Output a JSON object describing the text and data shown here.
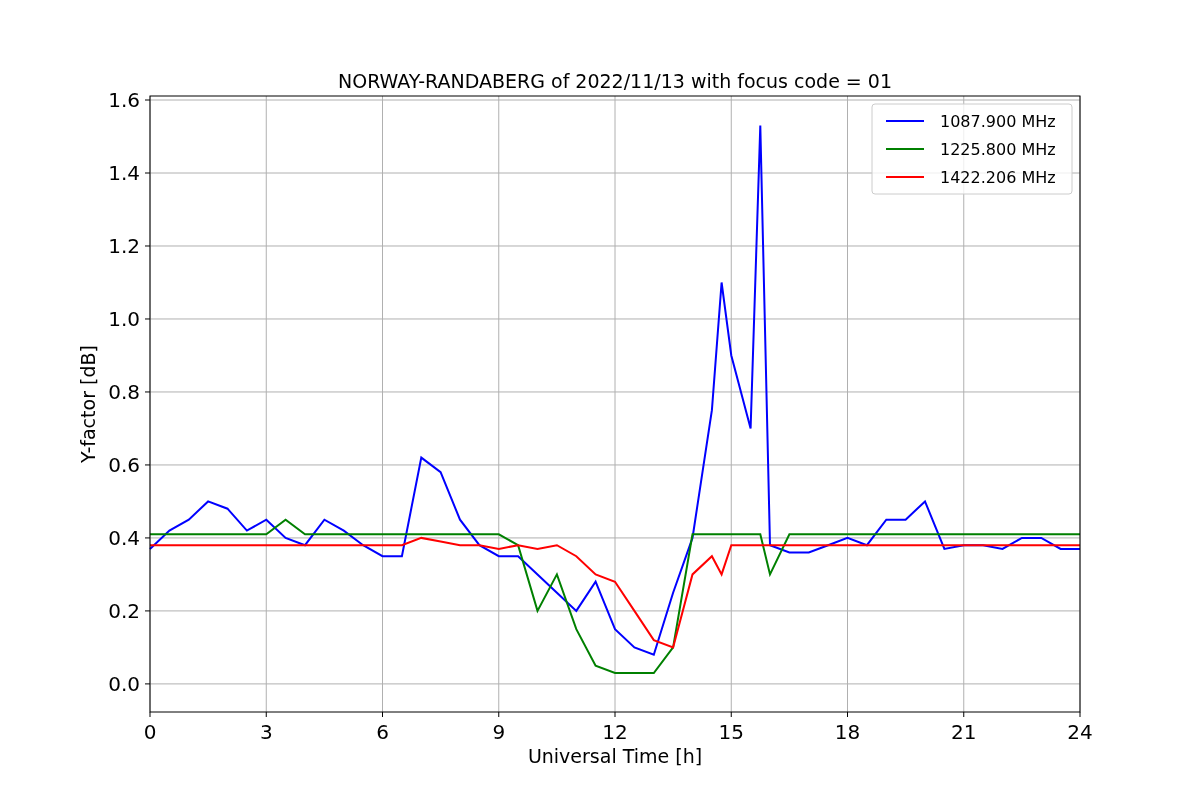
{
  "figure": {
    "chart_data": {
      "type": "line",
      "title": "NORWAY-RANDABERG of 2022/11/13 with focus code = 01",
      "xlabel": "Universal Time [h]",
      "ylabel": "Y-factor [dB]",
      "x": [
        0,
        0.5,
        1,
        1.5,
        2,
        2.5,
        3,
        3.5,
        4,
        4.5,
        5,
        5.5,
        6,
        6.5,
        7,
        7.5,
        8,
        8.5,
        9,
        9.5,
        10,
        10.5,
        11,
        11.5,
        12,
        12.5,
        13,
        13.5,
        14,
        14.5,
        14.75,
        15,
        15.5,
        15.75,
        16,
        16.5,
        17,
        17.5,
        18,
        18.5,
        19,
        19.5,
        20,
        20.5,
        21,
        21.5,
        22,
        22.5,
        23,
        23.5,
        24
      ],
      "series": [
        {
          "name": "1087.900 MHz",
          "color": "#0000ff",
          "values": [
            0.37,
            0.42,
            0.45,
            0.5,
            0.48,
            0.42,
            0.45,
            0.4,
            0.38,
            0.45,
            0.42,
            0.38,
            0.35,
            0.35,
            0.62,
            0.58,
            0.45,
            0.38,
            0.35,
            0.35,
            0.3,
            0.25,
            0.2,
            0.28,
            0.15,
            0.1,
            0.08,
            0.25,
            0.4,
            0.75,
            1.1,
            0.9,
            0.7,
            1.53,
            0.38,
            0.36,
            0.36,
            0.38,
            0.4,
            0.38,
            0.45,
            0.45,
            0.5,
            0.37,
            0.38,
            0.38,
            0.37,
            0.4,
            0.4,
            0.37,
            0.37
          ]
        },
        {
          "name": "1225.800 MHz",
          "color": "#008000",
          "values": [
            0.41,
            0.41,
            0.41,
            0.41,
            0.41,
            0.41,
            0.41,
            0.45,
            0.41,
            0.41,
            0.41,
            0.41,
            0.41,
            0.41,
            0.41,
            0.41,
            0.41,
            0.41,
            0.41,
            0.38,
            0.2,
            0.3,
            0.15,
            0.05,
            0.03,
            0.03,
            0.03,
            0.1,
            0.41,
            0.41,
            0.41,
            0.41,
            0.41,
            0.41,
            0.3,
            0.41,
            0.41,
            0.41,
            0.41,
            0.41,
            0.41,
            0.41,
            0.41,
            0.41,
            0.41,
            0.41,
            0.41,
            0.41,
            0.41,
            0.41,
            0.41
          ]
        },
        {
          "name": "1422.206 MHz",
          "color": "#ff0000",
          "values": [
            0.38,
            0.38,
            0.38,
            0.38,
            0.38,
            0.38,
            0.38,
            0.38,
            0.38,
            0.38,
            0.38,
            0.38,
            0.38,
            0.38,
            0.4,
            0.39,
            0.38,
            0.38,
            0.37,
            0.38,
            0.37,
            0.38,
            0.35,
            0.3,
            0.28,
            0.2,
            0.12,
            0.1,
            0.3,
            0.35,
            0.3,
            0.38,
            0.38,
            0.38,
            0.38,
            0.38,
            0.38,
            0.38,
            0.38,
            0.38,
            0.38,
            0.38,
            0.38,
            0.38,
            0.38,
            0.38,
            0.38,
            0.38,
            0.38,
            0.38,
            0.38
          ]
        }
      ],
      "grid": true,
      "legend": true,
      "xlim": [
        0,
        24
      ],
      "ylim": [
        -0.077,
        1.611
      ],
      "xticks": [
        0,
        3,
        6,
        9,
        12,
        15,
        18,
        21,
        24
      ],
      "yticks": [
        {
          "value": 0,
          "label": "0.0"
        },
        {
          "value": 0.2,
          "label": "0.2"
        },
        {
          "value": 0.4,
          "label": "0.4"
        },
        {
          "value": 0.6,
          "label": "0.6"
        },
        {
          "value": 0.8,
          "label": "0.8"
        },
        {
          "value": 1,
          "label": "1.0"
        },
        {
          "value": 1.2,
          "label": "1.2"
        },
        {
          "value": 1.4,
          "label": "1.4"
        },
        {
          "value": 1.6,
          "label": "1.6"
        }
      ]
    }
  }
}
